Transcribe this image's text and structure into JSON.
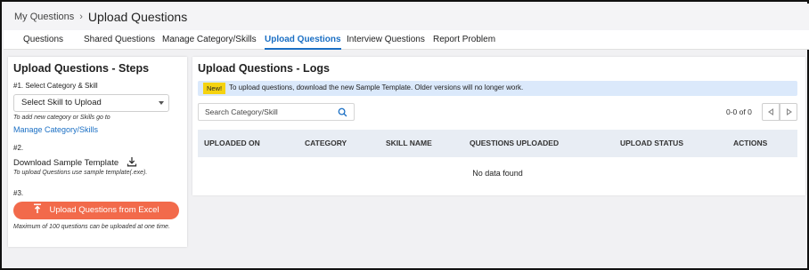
{
  "breadcrumb": {
    "parent": "My Questions",
    "separator": "›",
    "current": "Upload Questions"
  },
  "tabs": [
    {
      "label": "Questions"
    },
    {
      "label": "Shared Questions"
    },
    {
      "label": "Manage Category/Skills"
    },
    {
      "label": "Upload Questions",
      "active": true
    },
    {
      "label": "Interview Questions"
    },
    {
      "label": "Report Problem"
    }
  ],
  "steps_panel": {
    "title": "Upload Questions - Steps",
    "step1": {
      "label": "#1. Select Category & Skill",
      "select_value": "Select Skill to Upload",
      "note": "To add new category or Skills go to",
      "link": "Manage Category/Skills"
    },
    "step2": {
      "label": "#2.",
      "download_label": "Download Sample Template",
      "note": "To upload Questions use sample template(.exe)."
    },
    "step3": {
      "label": "#3.",
      "button_label": "Upload Questions from Excel",
      "note": "Maximum of 100 questions can be uploaded at one time."
    }
  },
  "logs_panel": {
    "title": "Upload Questions - Logs",
    "banner": {
      "badge": "New!",
      "text": "To upload questions, download the new Sample Template. Older versions will no longer work."
    },
    "search": {
      "placeholder": "Search Category/Skill",
      "value": ""
    },
    "pager": {
      "text": "0-0 of 0"
    },
    "table": {
      "columns": [
        "UPLOADED ON",
        "CATEGORY",
        "SKILL NAME",
        "QUESTIONS UPLOADED",
        "UPLOAD STATUS",
        "ACTIONS"
      ],
      "rows": [],
      "empty_text": "No data found"
    }
  },
  "colors": {
    "accent": "#1a6fc4",
    "upload_button": "#f26a4b",
    "banner_bg": "#dbe9fb",
    "badge_bg": "#f5d311",
    "table_header_bg": "#e8edf4"
  }
}
